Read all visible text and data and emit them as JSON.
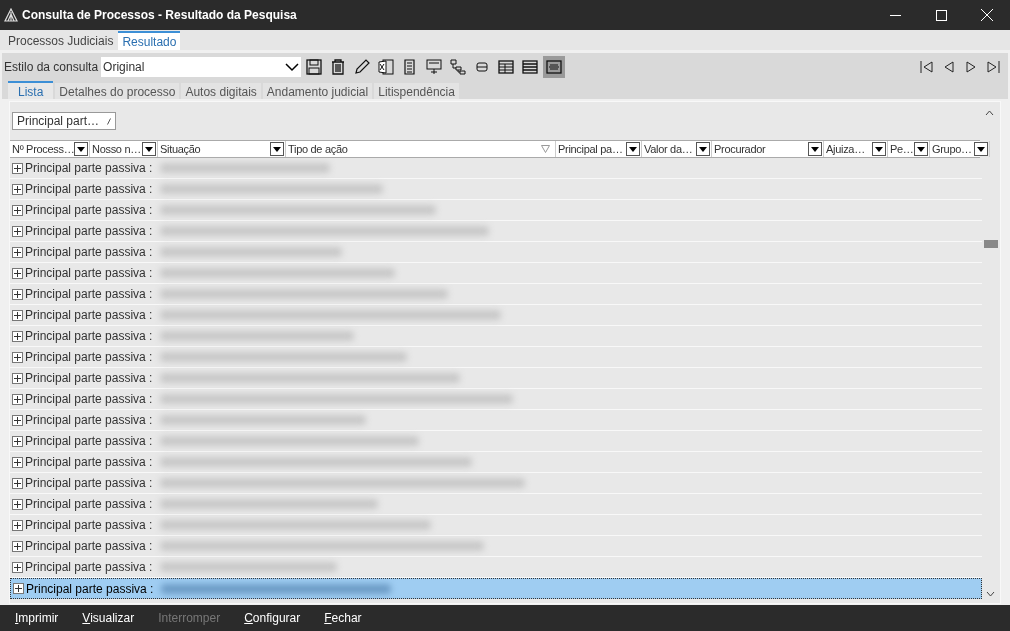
{
  "window": {
    "title": "Consulta de Processos - Resultado da Pesquisa"
  },
  "tabs": [
    {
      "label": "Processos Judiciais",
      "selected": false
    },
    {
      "label": "Resultado",
      "selected": true
    }
  ],
  "toolbar": {
    "style_label": "Estilo da consulta",
    "style_value": "Original",
    "buttons": [
      {
        "selected": false
      },
      {
        "selected": false
      },
      {
        "selected": false
      },
      {
        "selected": false
      },
      {
        "selected": false
      },
      {
        "selected": false
      },
      {
        "selected": false
      },
      {
        "selected": false
      },
      {
        "selected": false
      },
      {
        "selected": false
      },
      {
        "selected": true
      }
    ]
  },
  "subtabs": [
    {
      "label": "Lista",
      "selected": true
    },
    {
      "label": "Detalhes do processo",
      "selected": false
    },
    {
      "label": "Autos digitais",
      "selected": false
    },
    {
      "label": "Andamento judicial",
      "selected": false
    },
    {
      "label": "Litispendência",
      "selected": false
    }
  ],
  "group_by": "Principal part…",
  "columns": [
    {
      "label": "Nº Process…",
      "filtered": false
    },
    {
      "label": "Nosso n…",
      "filtered": false
    },
    {
      "label": "Situação",
      "filtered": false
    },
    {
      "label": "Tipo de ação",
      "filtered": true
    },
    {
      "label": "Principal pa…",
      "filtered": false
    },
    {
      "label": "Valor da…",
      "filtered": false
    },
    {
      "label": "Procurador",
      "filtered": false
    },
    {
      "label": "Ajuiza…",
      "filtered": false
    },
    {
      "label": "Pe…",
      "filtered": false
    },
    {
      "label": "Grupo…",
      "filtered": false
    }
  ],
  "rows": [
    {
      "label": "Principal parte passiva :",
      "selected": false
    },
    {
      "label": "Principal parte passiva :",
      "selected": false
    },
    {
      "label": "Principal parte passiva :",
      "selected": false
    },
    {
      "label": "Principal parte passiva :",
      "selected": false
    },
    {
      "label": "Principal parte passiva :",
      "selected": false
    },
    {
      "label": "Principal parte passiva :",
      "selected": false
    },
    {
      "label": "Principal parte passiva :",
      "selected": false
    },
    {
      "label": "Principal parte passiva :",
      "selected": false
    },
    {
      "label": "Principal parte passiva :",
      "selected": false
    },
    {
      "label": "Principal parte passiva :",
      "selected": false
    },
    {
      "label": "Principal parte passiva :",
      "selected": false
    },
    {
      "label": "Principal parte passiva :",
      "selected": false
    },
    {
      "label": "Principal parte passiva :",
      "selected": false
    },
    {
      "label": "Principal parte passiva :",
      "selected": false
    },
    {
      "label": "Principal parte passiva :",
      "selected": false
    },
    {
      "label": "Principal parte passiva :",
      "selected": false
    },
    {
      "label": "Principal parte passiva :",
      "selected": false
    },
    {
      "label": "Principal parte passiva :",
      "selected": false
    },
    {
      "label": "Principal parte passiva :",
      "selected": false
    },
    {
      "label": "Principal parte passiva :",
      "selected": false
    },
    {
      "label": "Principal parte passiva :",
      "selected": true
    }
  ],
  "actions": [
    {
      "label": "Imprimir",
      "disabled": false
    },
    {
      "label": "Visualizar",
      "disabled": false
    },
    {
      "label": "Interromper",
      "disabled": true
    },
    {
      "label": "Configurar",
      "disabled": false
    },
    {
      "label": "Fechar",
      "disabled": false
    }
  ]
}
